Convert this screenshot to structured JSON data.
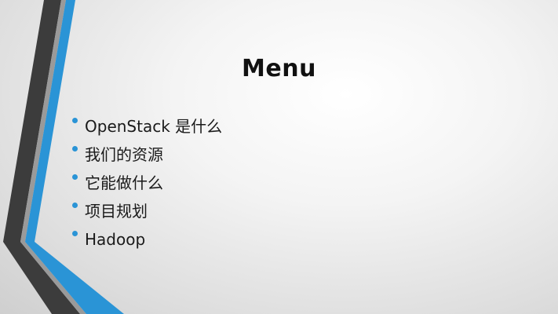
{
  "slide": {
    "title": "Menu",
    "bullets": [
      {
        "text": "OpenStack 是什么"
      },
      {
        "text": "我们的资源"
      },
      {
        "text": "它能做什么"
      },
      {
        "text": "项目规划"
      },
      {
        "text": "Hadoop"
      }
    ]
  },
  "colors": {
    "accent": "#2a94d6",
    "stripe_dark": "#3c3c3c",
    "title_text": "#111111",
    "body_text": "#1a1a1a"
  }
}
